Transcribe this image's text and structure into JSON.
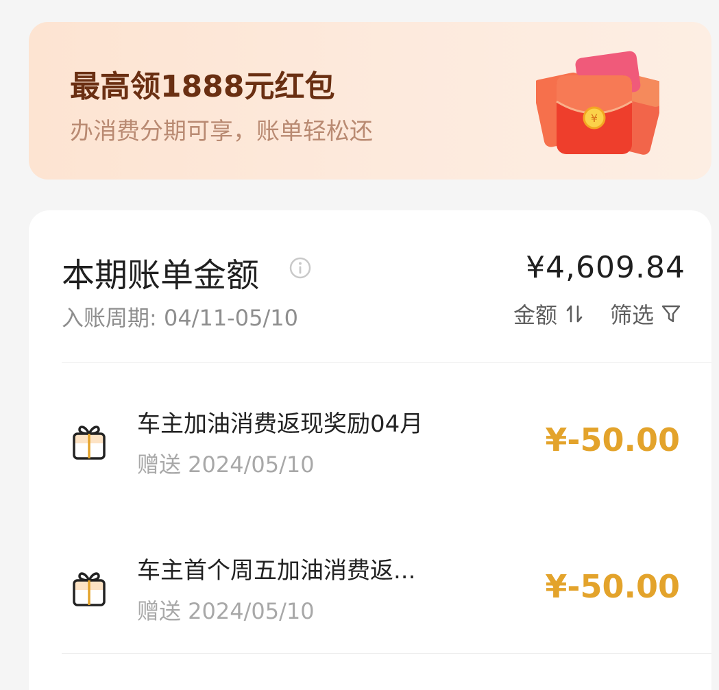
{
  "banner": {
    "title": "最高领1888元红包",
    "subtitle": "办消费分期可享，账单轻松还",
    "image_icon": "red-envelope-icon"
  },
  "bill": {
    "title": "本期账单金额",
    "amount": "¥4,609.84",
    "period": "入账周期: 04/11-05/10",
    "sort_label": "金额",
    "filter_label": "筛选"
  },
  "transactions": [
    {
      "icon": "gift-icon",
      "title": "车主加油消费返现奖励04月",
      "subtitle": "赠送 2024/05/10",
      "amount": "¥-50.00"
    },
    {
      "icon": "gift-icon",
      "title": "车主首个周五加油消费返...",
      "subtitle": "赠送 2024/05/10",
      "amount": "¥-50.00"
    }
  ],
  "colors": {
    "accent_amount": "#e3a32b",
    "banner_title": "#6a2f12"
  }
}
